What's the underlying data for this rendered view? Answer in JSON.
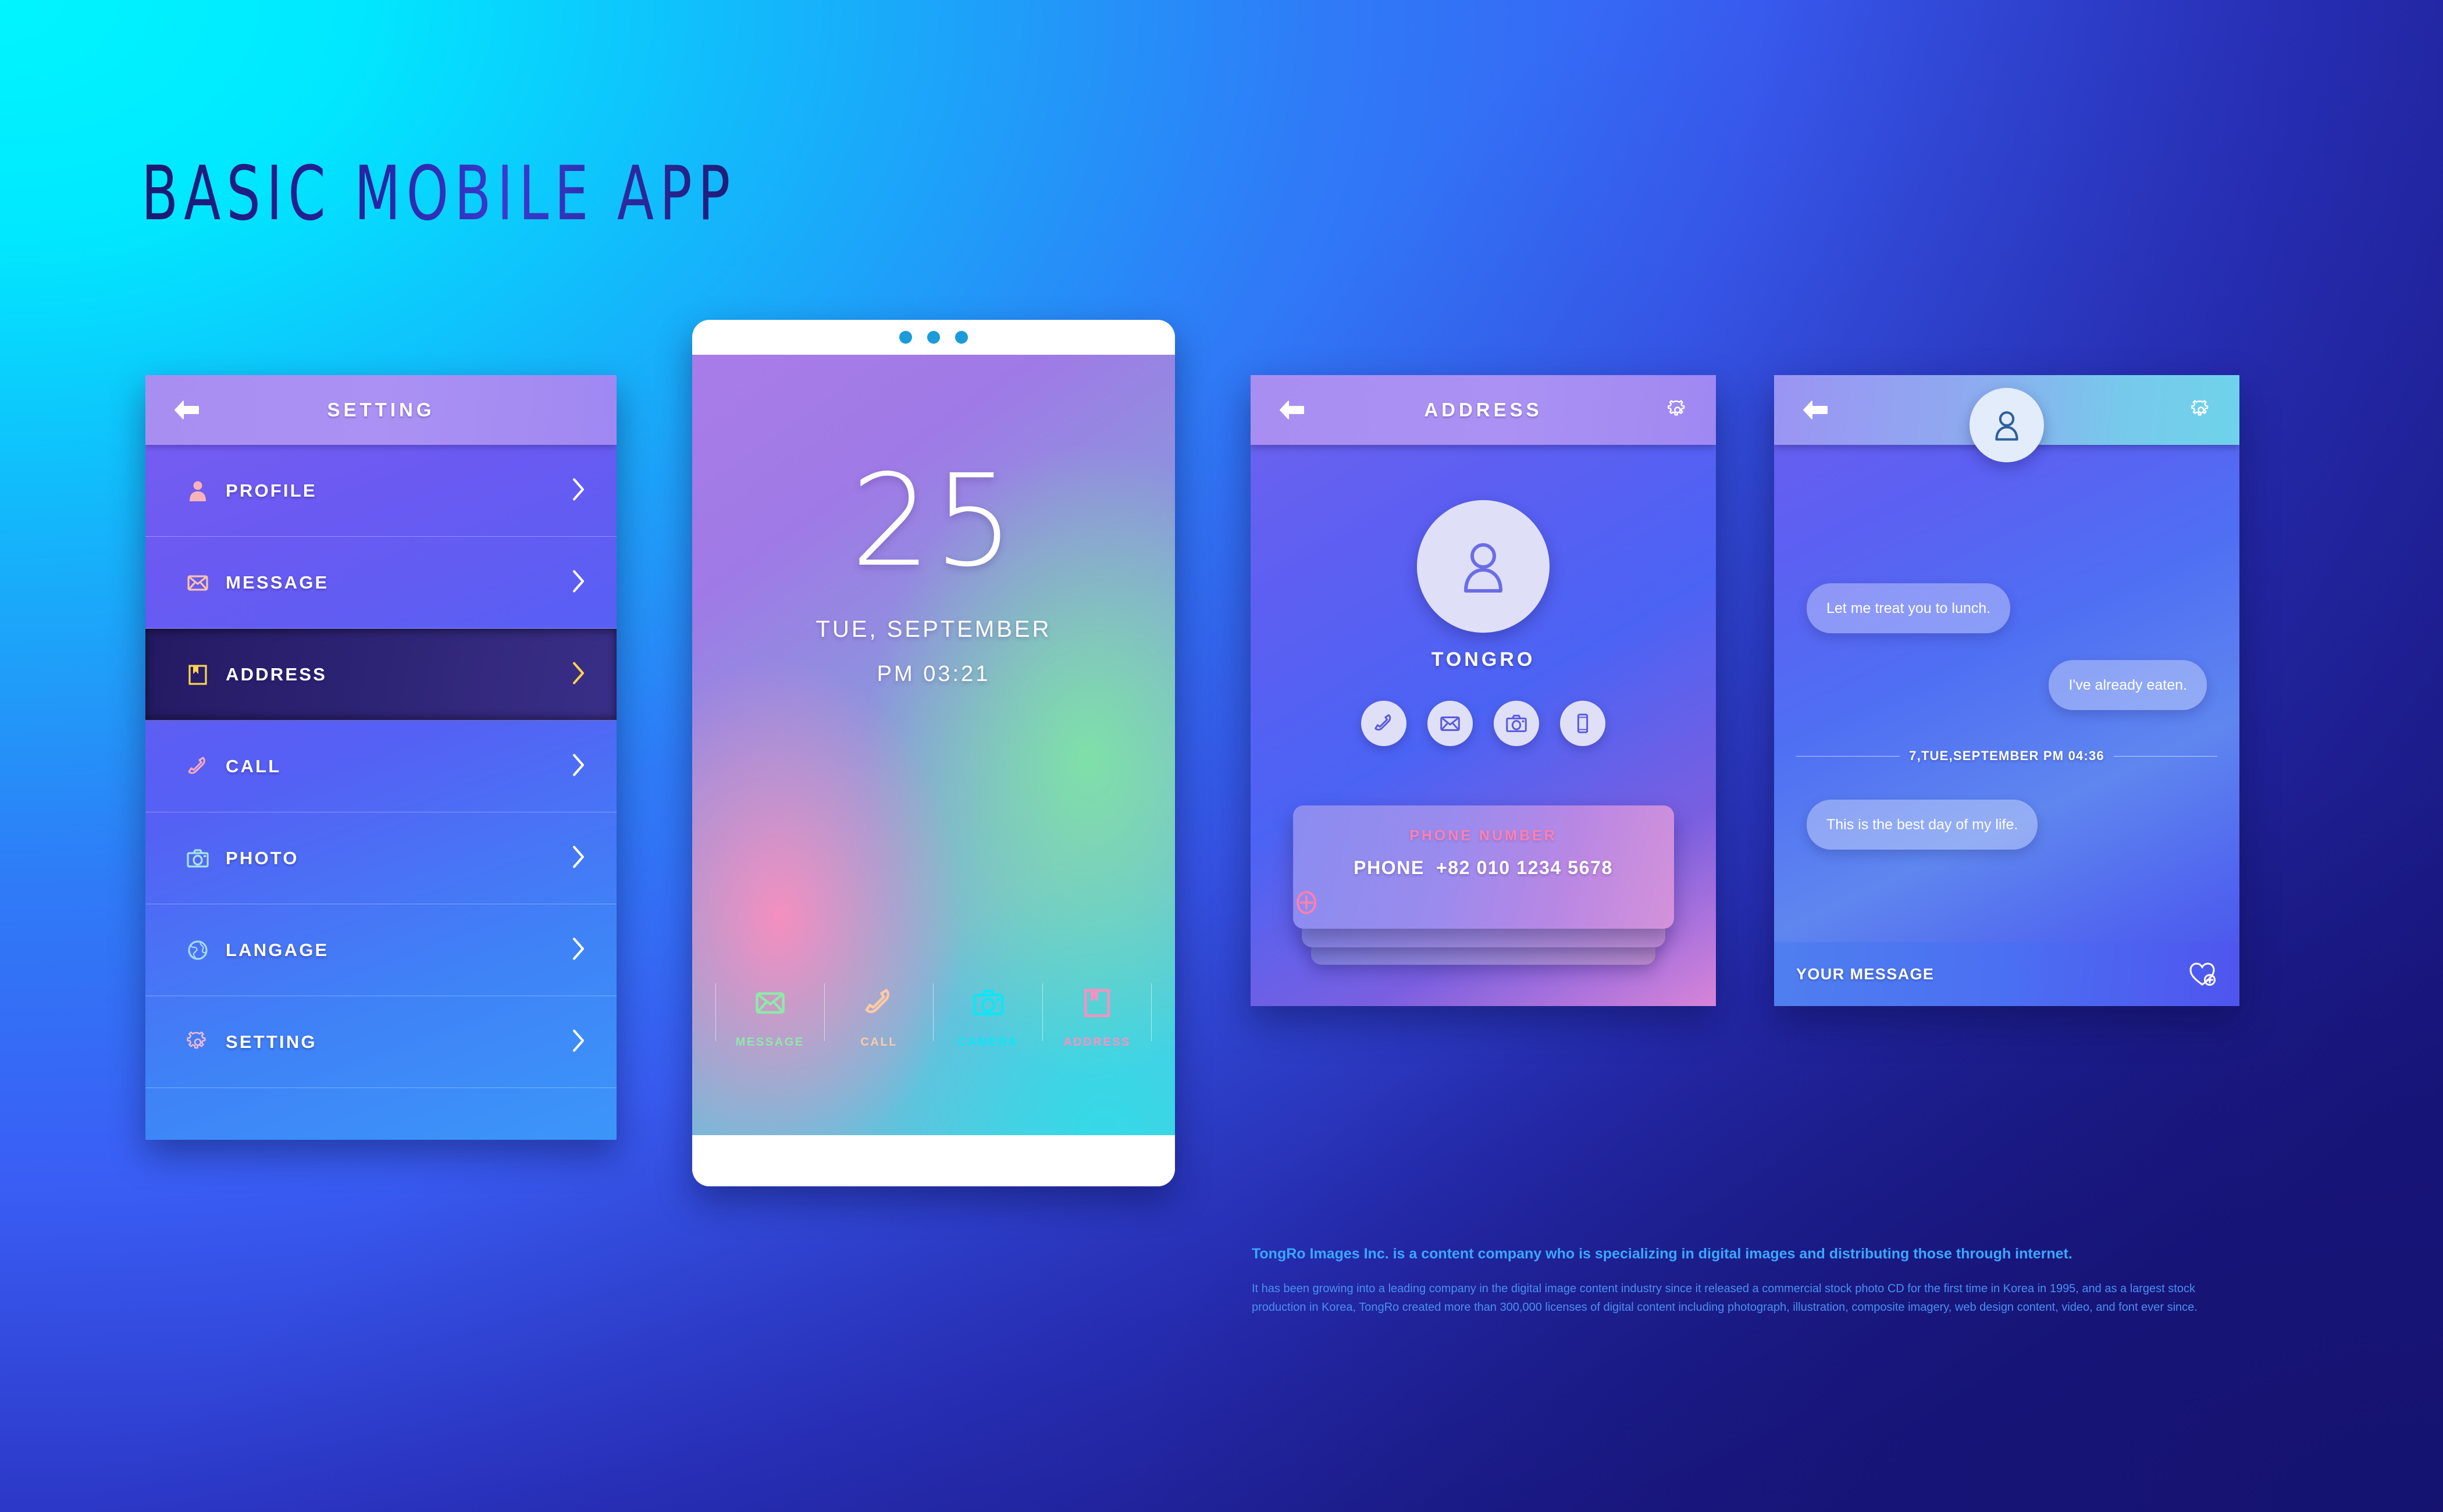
{
  "page": {
    "title": "BASIC MOBILE APP"
  },
  "colors": {
    "bg_top_left": "#00F5FF",
    "bg_top_right": "#4070F8",
    "bg_bottom_left": "#4070F8",
    "bg_bottom_right": "#18167E",
    "accent_pink": "#FF7FB0",
    "accent_yellow": "#FFD34D",
    "header_purple": "#AB91F3",
    "title_navy": "#1B1A6E"
  },
  "sidebar": {
    "header": {
      "title": "SETTING",
      "back_icon": "back-arrow-icon"
    },
    "items": [
      {
        "label": "PROFILE",
        "icon": "person-icon",
        "color": "#F7B3B8",
        "active": false
      },
      {
        "label": "MESSAGE",
        "icon": "envelope-icon",
        "color": "#F8C3A8",
        "active": false
      },
      {
        "label": "ADDRESS",
        "icon": "book-icon",
        "color": "#FFD34D",
        "active": true
      },
      {
        "label": "CALL",
        "icon": "phone-icon",
        "color": "#F8A8BE",
        "active": false
      },
      {
        "label": "PHOTO",
        "icon": "camera-icon",
        "color": "#A8E4E8",
        "active": false
      },
      {
        "label": "LANGAGE",
        "icon": "globe-icon",
        "color": "#A8D8F0",
        "active": false
      },
      {
        "label": "SETTING",
        "icon": "gear-icon",
        "color": "#F0B8D8",
        "active": false
      }
    ]
  },
  "lockscreen": {
    "dots": 3,
    "day_number": "25",
    "date_line": "TUE, SEPTEMBER",
    "time_line": "PM 03:21",
    "dock": [
      {
        "label": "MESSAGE",
        "icon": "envelope-icon",
        "color": "#8FE8A8"
      },
      {
        "label": "CALL",
        "icon": "phone-icon",
        "color": "#FFCBA4"
      },
      {
        "label": "CAMERA",
        "icon": "camera-icon",
        "color": "#0FE5F5"
      },
      {
        "label": "ADDRESS",
        "icon": "book-icon",
        "color": "#FF8FC0"
      }
    ]
  },
  "address_screen": {
    "header": {
      "title": "ADDRESS",
      "back_icon": "back-arrow-icon",
      "settings_icon": "gear-icon"
    },
    "avatar_icon": "person-avatar-icon",
    "user_name": "TONGRO",
    "actions": [
      {
        "icon": "phone-icon",
        "name": "call-action"
      },
      {
        "icon": "envelope-icon",
        "name": "mail-action"
      },
      {
        "icon": "camera-icon",
        "name": "camera-action"
      },
      {
        "icon": "mobile-icon",
        "name": "mobile-action"
      }
    ],
    "card": {
      "label": "PHONE NUMBER",
      "field_key": "PHONE",
      "field_value": "+82 010 1234 5678",
      "add_icon": "plus-circle-icon"
    }
  },
  "chat_screen": {
    "header": {
      "back_icon": "back-arrow-icon",
      "settings_icon": "gear-icon",
      "avatar_icon": "person-avatar-icon"
    },
    "messages": [
      {
        "text": "Let me treat you to lunch.",
        "side": "left"
      },
      {
        "text": "I've already eaten.",
        "side": "right"
      }
    ],
    "date_divider": "7,TUE,SEPTEMBER   PM 04:36",
    "messages_after": [
      {
        "text": "This is the best day of my life.",
        "side": "left"
      }
    ],
    "input": {
      "placeholder": "YOUR MESSAGE",
      "send_icon": "heart-plus-icon"
    }
  },
  "footer": {
    "lead": "TongRo Images Inc. is a content company who is specializing in digital images and distributing those through internet.",
    "body": "It has been growing into a leading company in the digital image content industry since it released a commercial stock photo CD for the first time in Korea in 1995, and as a largest stock production in Korea, TongRo created more than 300,000 licenses of digital content including photograph, illustration, composite imagery, web design content, video, and font ever since."
  }
}
